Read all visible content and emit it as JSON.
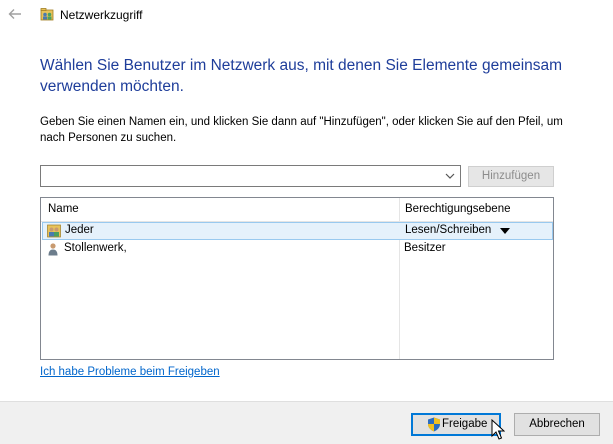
{
  "window": {
    "title": "Netzwerkzugriff",
    "back_icon": "back-arrow-icon",
    "title_icon": "network-share-icon"
  },
  "main": {
    "heading": "Wählen Sie Benutzer im Netzwerk aus, mit denen Sie Elemente gemeinsam verwenden möchten.",
    "instructions": "Geben Sie einen Namen ein, und klicken Sie dann auf \"Hinzufügen\", oder klicken Sie auf den Pfeil, um nach Personen zu suchen.",
    "name_input": {
      "value": "",
      "placeholder": ""
    },
    "add_button": "Hinzufügen",
    "add_button_enabled": false
  },
  "list": {
    "columns": [
      "Name",
      "Berechtigungsebene"
    ],
    "rows": [
      {
        "name": "Jeder",
        "permission": "Lesen/Schreiben",
        "icon": "users-group-icon",
        "selected": true,
        "has_dropdown": true
      },
      {
        "name": "Stollenwerk,",
        "permission": "Besitzer",
        "icon": "user-icon",
        "selected": false,
        "has_dropdown": false
      }
    ]
  },
  "help_link": "Ich habe Probleme beim Freigeben",
  "footer": {
    "share_button": "Freigabe",
    "share_icon": "uac-shield-icon",
    "cancel_button": "Abbrechen"
  },
  "colors": {
    "heading": "#1e3d9a",
    "link": "#0066cc",
    "selection_bg": "#e5f1fb",
    "selection_border": "#99c9ef",
    "default_button_border": "#0078d7",
    "footer_bg": "#f0f0f0"
  }
}
